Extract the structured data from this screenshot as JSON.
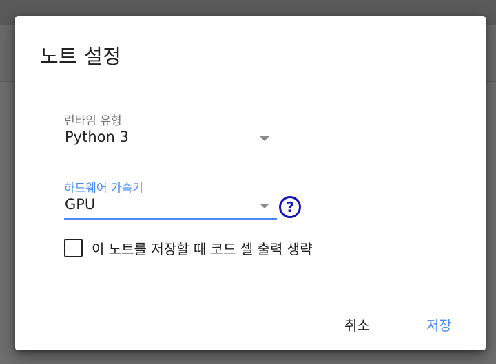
{
  "dialog": {
    "title": "노트 설정",
    "runtime": {
      "label": "런타임 유형",
      "value": "Python 3"
    },
    "accelerator": {
      "label": "하드웨어 가속기",
      "value": "GPU",
      "help_icon": "question-circle-icon",
      "help_glyph": "?"
    },
    "omit_output": {
      "label": "이 노트를 저장할 때 코드 셀 출력 생략",
      "checked": false
    },
    "buttons": {
      "cancel": "취소",
      "save": "저장"
    }
  },
  "colors": {
    "accent": "#4a8af4",
    "help_icon": "#1414b8",
    "backdrop": "#6f6f6f"
  }
}
